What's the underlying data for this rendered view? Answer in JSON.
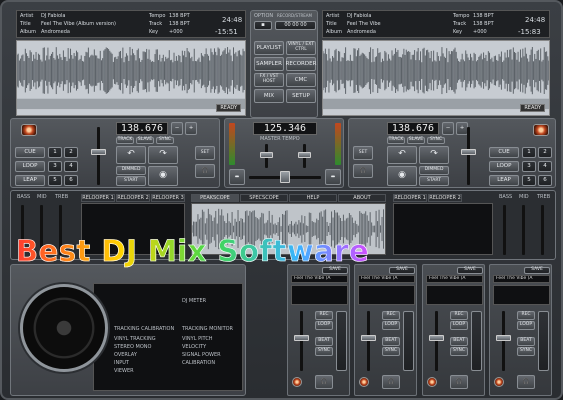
{
  "deck_left": {
    "artist_label": "Artist",
    "artist": "DJ Fabiola",
    "title_label": "Title",
    "title": "Feel The Vibe (Album version)",
    "album_label": "Album",
    "album": "Andromeda",
    "tempo_label": "Tempo",
    "tempo": "138 BPT",
    "track_label": "Track",
    "track": "138 BPT",
    "key_label": "Key",
    "key": "+000",
    "time": "24:48",
    "remain": "-15:51",
    "ready": "READY",
    "bpm": "138.676",
    "track_btn": "TRACK",
    "slave_btn": "SLAVE",
    "sync_btn": "SYNC",
    "cue": "CUE",
    "loop": "LOOP",
    "leap": "LEAP",
    "pads": [
      "1",
      "2",
      "3",
      "4",
      "5",
      "6"
    ],
    "dim": "DIMMED",
    "start": "START",
    "set": "SET"
  },
  "deck_right": {
    "artist_label": "Artist",
    "artist": "DJ Fabiola",
    "title_label": "Title",
    "title": "Feel The Vibe",
    "album_label": "Album",
    "album": "Andromeda",
    "tempo_label": "Tempo",
    "tempo": "138 BPT",
    "track_label": "Track",
    "track": "138 BPT",
    "key_label": "Key",
    "key": "+000",
    "time": "24:48",
    "remain": "-15:83",
    "ready": "READY",
    "bpm": "138.676",
    "track_btn": "TRACK",
    "slave_btn": "SLAVE",
    "sync_btn": "SYNC",
    "cue": "CUE",
    "loop": "LOOP",
    "leap": "LEAP",
    "pads": [
      "1",
      "2",
      "3",
      "4",
      "5",
      "6"
    ],
    "dim": "DIMMED",
    "start": "START",
    "set": "SET"
  },
  "center": {
    "option_label": "OPTION",
    "record_label": "RECORD/STREAM",
    "clock": "00 00 00",
    "buttons": [
      "PLAYLIST",
      "VINYL / EXT CTRL",
      "SAMPLER",
      "RECORDER",
      "FX / VST HOST",
      "CMC",
      "MIX",
      "SETUP"
    ],
    "master_bpm": "125.346",
    "master_tempo_label": "MASTER TEMPO"
  },
  "eq_labels_left": [
    "BASS",
    "MID",
    "TREB"
  ],
  "eq_labels_right": [
    "BASS",
    "MID",
    "TREB"
  ],
  "tabs_left": [
    "RELOOPER 1",
    "RELOOPER 2",
    "RELOOPER 3"
  ],
  "tabs_center": [
    "PEAKSCOPE",
    "SPECSCOPE",
    "HELP",
    "ABOUT"
  ],
  "tabs_right": [
    "RELOOPER 1",
    "RELOOPER 2"
  ],
  "banner": "Best DJ Mix Software",
  "bottom_left": {
    "meter_label": "DJ METER",
    "calibration": "TRACKING CALIBRATION",
    "monitor": "TRACKING MONITOR",
    "rows_left": [
      "VINYL TRACKING",
      "STEREO MONO",
      "OVERLAY",
      "INPUT",
      "VIEWER"
    ],
    "rows_right": [
      "VINYL PITCH",
      "VELOCITY",
      "SIGNAL POWER",
      "CALIBRATION"
    ]
  },
  "strips": [
    {
      "title": "Feel The Vibe (A",
      "save": "SAVE",
      "rec": "REC",
      "loop": "LOOP",
      "beat": "BEAT",
      "sync": "SYNC"
    },
    {
      "title": "Feel The Vibe (A",
      "save": "SAVE",
      "rec": "REC",
      "loop": "LOOP",
      "beat": "BEAT",
      "sync": "SYNC"
    },
    {
      "title": "Feel The Vibe (A",
      "save": "SAVE",
      "rec": "REC",
      "loop": "LOOP",
      "beat": "BEAT",
      "sync": "SYNC"
    },
    {
      "title": "Feel The Vibe (A",
      "save": "SAVE",
      "rec": "REC",
      "loop": "LOOP",
      "beat": "BEAT",
      "sync": "SYNC"
    }
  ],
  "colors": {
    "accent": "#c2471f",
    "waveform": "#5c6268",
    "screen": "#1e2023"
  }
}
